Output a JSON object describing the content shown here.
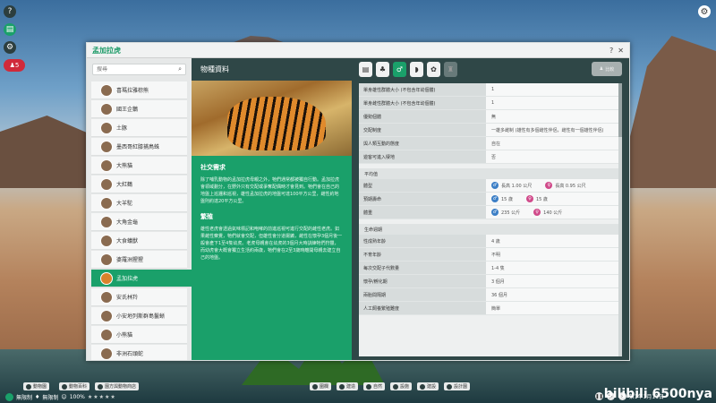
{
  "hud": {
    "guest_count": "5"
  },
  "window": {
    "title": "孟加拉虎",
    "help": "?",
    "close": "✕"
  },
  "sidebar": {
    "search_placeholder": "搜尋",
    "items": [
      {
        "label": "喜瑪拉雅棕熊"
      },
      {
        "label": "國王企鵝"
      },
      {
        "label": "土豚"
      },
      {
        "label": "墨西哥紅膝捕鳥蛛"
      },
      {
        "label": "大熊貓"
      },
      {
        "label": "大紅鶴"
      },
      {
        "label": "大羊駝"
      },
      {
        "label": "大角金龜"
      },
      {
        "label": "大食蟻獸"
      },
      {
        "label": "婆羅洲猩猩"
      },
      {
        "label": "孟加拉虎",
        "selected": true
      },
      {
        "label": "安氏林羚"
      },
      {
        "label": "小安地列斯群島鬣蜥"
      },
      {
        "label": "小熊貓"
      },
      {
        "label": "非洲石頭蛇"
      }
    ]
  },
  "center": {
    "header": "物種資料",
    "social_title": "社交需求",
    "social_text": "除了哺乳動物的孟加拉虎母親之外，牠們通常都被獨自行動。孟加拉虎會領域劃分，在野外只有交配或爭奪配偶時才會見到。牠們會在自己的地盤上巡邏和巡視，雄性孟加拉虎的地盤可達100平方公里，雌性約地盤則約達20平方公里。",
    "breeding_title": "繁殖",
    "breeding_text": "雄性老虎會透過氣味標記和咆哮的前進巡視可進行交配的雌性老虎。如果雌性察覺，牠們就會交配，但雄性會分道揚鑣，雌性在懷孕3個月後一般會產下1至4隻幼虎。老虎母親會在幼虎的3個月大時訓練牠們狩獵，而幼虎會大概會獨立生活約兩歲，牠們會在2至3歲時離開母親去建立自己的地盤。"
  },
  "right": {
    "compare_label": "比較",
    "group": [
      {
        "k": "單身雄性群體大小 (不包含年幼個體)",
        "v": "1"
      },
      {
        "k": "單身雌性群體大小 (不包含年幼個體)",
        "v": "1"
      },
      {
        "k": "優勢個體",
        "v": "無"
      },
      {
        "k": "交配制度",
        "v": "一雄多雌制 (雄性有多個雌性伴侶，雌性有一個雄性伴侶)"
      },
      {
        "k": "與人類互動的態度",
        "v": "自在"
      },
      {
        "k": "遊客可進入棲地",
        "v": "否"
      }
    ],
    "avg_title": "平均值",
    "avg": [
      {
        "k": "體型",
        "m": "長高 1.00 公尺",
        "f": "長高 0.95 公尺"
      },
      {
        "k": "預期壽命",
        "m": "15 歲",
        "f": "15 歲"
      },
      {
        "k": "體重",
        "m": "235 公斤",
        "f": "140 公斤"
      }
    ],
    "life_title": "生命週期",
    "life": [
      {
        "k": "性成熟年齡",
        "v": "4 歲"
      },
      {
        "k": "不育年齡",
        "v": "不明"
      },
      {
        "k": "每次交配子代數量",
        "v": "1-4 隻"
      },
      {
        "k": "懷孕/孵化期",
        "v": "3 個月"
      },
      {
        "k": "兩胎間隔期",
        "v": "36 個月"
      },
      {
        "k": "人工飼養繁殖難度",
        "v": "簡單"
      }
    ]
  },
  "bottom": {
    "btn_animals": "動物園",
    "btn_zoo_info": "動物百科",
    "btn_shop": "園方與動物商店",
    "status1": "無限制",
    "status2": "無限制",
    "status3": "100%",
    "toolbar": [
      "圍欄",
      "建造",
      "自然",
      "設施",
      "建設",
      "設計園"
    ],
    "date": "第1年1月11日",
    "watermark": "bilibili 6500nya"
  }
}
